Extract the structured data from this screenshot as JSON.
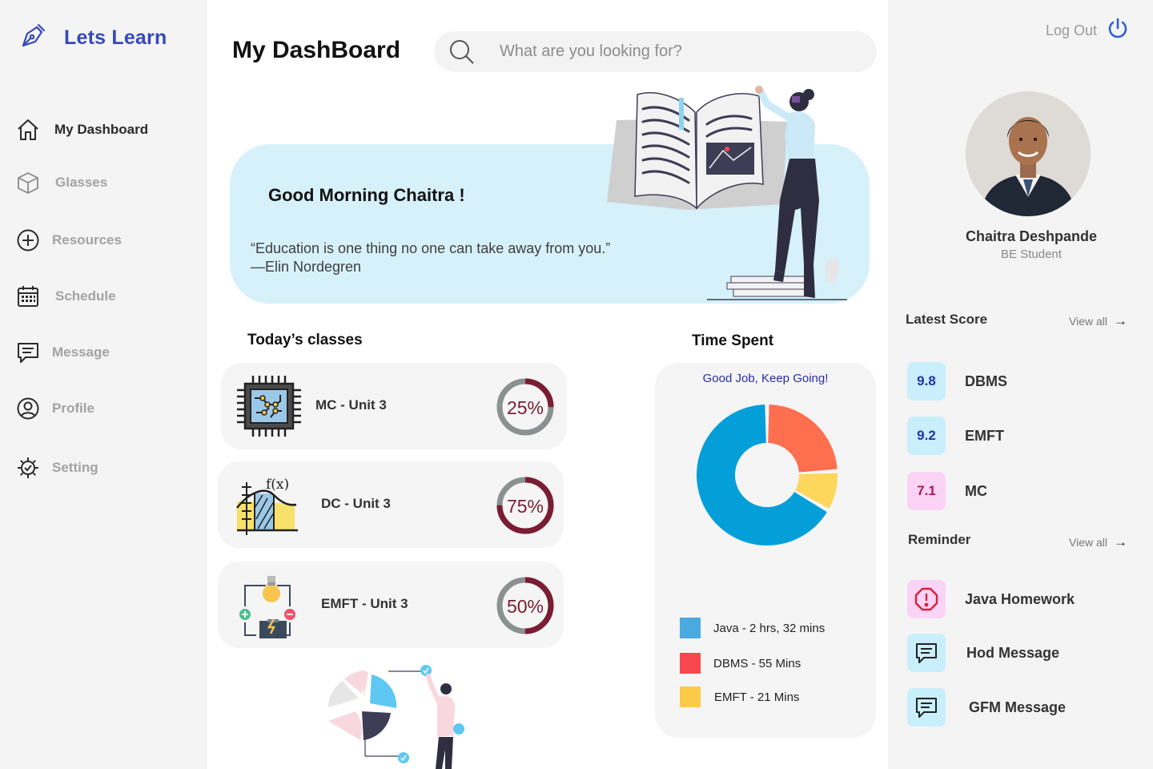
{
  "app": {
    "title": "Lets Learn"
  },
  "sidebar": {
    "items": [
      {
        "label": "My Dashboard",
        "icon": "home-icon"
      },
      {
        "label": "Glasses",
        "icon": "cube-icon"
      },
      {
        "label": "Resources",
        "icon": "plus-circle-icon"
      },
      {
        "label": "Schedule",
        "icon": "calendar-icon"
      },
      {
        "label": "Message",
        "icon": "message-icon"
      },
      {
        "label": "Profile",
        "icon": "user-icon"
      },
      {
        "label": "Setting",
        "icon": "gear-icon"
      }
    ]
  },
  "header": {
    "title": "My DashBoard",
    "search_placeholder": "What are you looking for?"
  },
  "hero": {
    "greeting": "Good Morning Chaitra !",
    "quote_line1": "“Education is one thing no one can take away from you.”",
    "quote_line2": "—Elin Nordegren"
  },
  "classes": {
    "title": "Today’s classes",
    "items": [
      {
        "name": "MC - Unit 3",
        "progress": 25,
        "progress_label": "25%",
        "icon": "chip-icon"
      },
      {
        "name": "DC - Unit 3",
        "progress": 75,
        "progress_label": "75%",
        "icon": "function-graph-icon"
      },
      {
        "name": "EMFT - Unit 3",
        "progress": 50,
        "progress_label": "50%",
        "icon": "circuit-bulb-icon"
      }
    ]
  },
  "time_spent": {
    "title": "Time Spent",
    "subtitle": "Good Job, Keep Going!",
    "legend": [
      {
        "label": "Java - 2  hrs, 32 mins",
        "color": "#4aaae0"
      },
      {
        "label": "DBMS - 55 Mins",
        "color": "#f7484e"
      },
      {
        "label": "EMFT - 21  Mins",
        "color": "#fcca47"
      }
    ]
  },
  "chart_data": {
    "type": "pie",
    "title": "Time Spent",
    "categories": [
      "Java",
      "DBMS",
      "EMFT"
    ],
    "values": [
      152,
      55,
      21
    ],
    "units": "mins",
    "colors": [
      "#049fd9",
      "#fe6f50",
      "#fdd65c"
    ]
  },
  "profile": {
    "logout_label": "Log Out",
    "name": "Chaitra Deshpande",
    "role": "BE Student"
  },
  "scores": {
    "title": "Latest Score",
    "view_all": "View all",
    "items": [
      {
        "value": "9.8",
        "subject": "DBMS",
        "bg": "#c9eefc",
        "fg": "#2233aa"
      },
      {
        "value": "9.2",
        "subject": "EMFT",
        "bg": "#c9eefc",
        "fg": "#2233aa"
      },
      {
        "value": "7.1",
        "subject": "MC",
        "bg": "#fbd3f5",
        "fg": "#b3174a"
      }
    ]
  },
  "reminders": {
    "title": "Reminder",
    "view_all": "View all",
    "items": [
      {
        "label": "Java Homework",
        "icon": "alert-octagon-icon",
        "bg": "#fbd3f5"
      },
      {
        "label": "Hod Message",
        "icon": "message-icon",
        "bg": "#c9eefc"
      },
      {
        "label": "GFM Message",
        "icon": "message-icon",
        "bg": "#c9eefc"
      }
    ]
  }
}
